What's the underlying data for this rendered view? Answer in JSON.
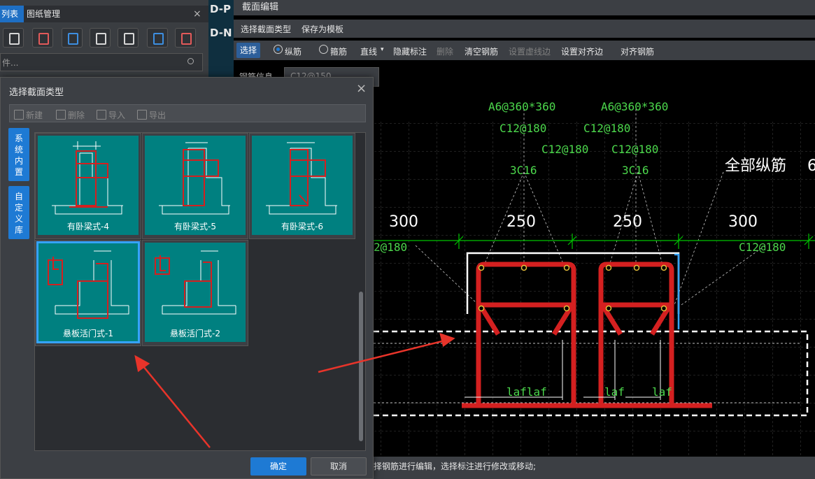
{
  "left_panel": {
    "tab_list": "列表",
    "tab_drawings": "图纸管理",
    "tab_close": "×",
    "search_placeholder": "件...",
    "gap_text_1": "D-P",
    "gap_text_2": "D-N"
  },
  "section_editor": {
    "title": "截面编辑",
    "menu": [
      "选择截面类型",
      "保存为模板"
    ],
    "toolbar": {
      "select": "选择",
      "longitudinal": "纵筋",
      "stirrup": "箍筋",
      "line": "直线",
      "hide_label": "隐藏标注",
      "delete": "删除",
      "clear_rebar": "清空钢筋",
      "set_dashed_edge": "设置虚线边",
      "set_align_edge": "设置对齐边",
      "align_rebar": "对齐钢筋"
    },
    "info_label": "钢筋信息",
    "info_value": "C12@150",
    "status": "择钢筋进行编辑，选择标注进行修改或移动;"
  },
  "drawing": {
    "labels": {
      "a6_left": "A6@360*360",
      "a6_right": "A6@360*360",
      "c12_1": "C12@180",
      "c12_2": "C12@180",
      "c12_3": "C12@180",
      "c12_4": "C12@180",
      "c16_left": "3C16",
      "c16_right": "3C16",
      "all_long": "全部纵筋",
      "all_long_suffix": "6",
      "c12_side_left": "2@180",
      "c12_side_right": "C12@180",
      "laf_1": "laflaf",
      "laf_2": "laf",
      "laf_3": "laf"
    },
    "dimensions": [
      "300",
      "250",
      "250",
      "300"
    ],
    "colors": {
      "dim": "#00c400",
      "rebar": "#d42020",
      "label_green": "#4cd84c"
    }
  },
  "dialog": {
    "title": "选择截面类型",
    "close": "×",
    "toolbar": {
      "new": "新建",
      "delete": "删除",
      "import": "导入",
      "export": "导出"
    },
    "tabs": [
      "系统内置",
      "自定义库"
    ],
    "templates": [
      {
        "label": "有卧梁式-4",
        "selected": false
      },
      {
        "label": "有卧梁式-5",
        "selected": false
      },
      {
        "label": "有卧梁式-6",
        "selected": false
      },
      {
        "label": "悬板活门式-1",
        "selected": true
      },
      {
        "label": "悬板活门式-2",
        "selected": false
      }
    ],
    "ok": "确定",
    "cancel": "取消"
  }
}
